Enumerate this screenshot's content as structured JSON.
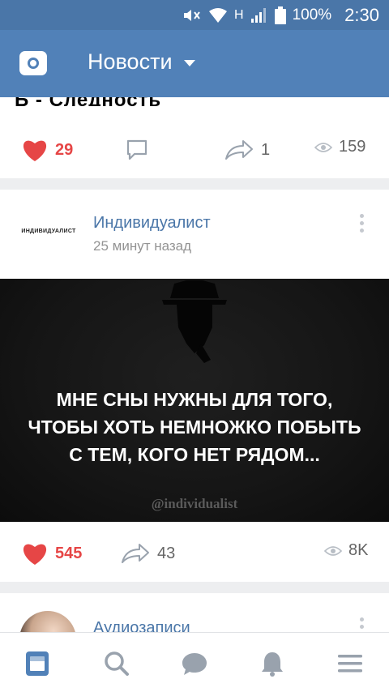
{
  "status_bar": {
    "network_label": "H",
    "battery": "100%",
    "time": "2:30"
  },
  "header": {
    "title": "Новости"
  },
  "posts": [
    {
      "cut_text": "Б - Следность",
      "likes": "29",
      "reposts": "1",
      "views": "159"
    },
    {
      "avatar_text": "ИНДИВИДУАЛИСТ",
      "author": "Индивидуалист",
      "time": "25 минут назад",
      "image_text_lines": [
        "МНЕ СНЫ НУЖНЫ ДЛЯ ТОГО,",
        "ЧТОБЫ ХОТЬ НЕМНОЖКО ПОБЫТЬ",
        "С ТЕМ, КОГО НЕТ РЯДОМ..."
      ],
      "watermark": "@individualist",
      "likes": "545",
      "reposts": "43",
      "views": "8K"
    },
    {
      "author": "Аудиозаписи"
    }
  ],
  "bottom_nav": [
    "news-icon",
    "search-icon",
    "messages-icon",
    "notifications-icon",
    "menu-icon"
  ],
  "colors": {
    "header_bg": "#5181b8",
    "statusbar_bg": "#4a76a8",
    "like_red": "#e64646",
    "link_blue": "#4a76a8"
  }
}
